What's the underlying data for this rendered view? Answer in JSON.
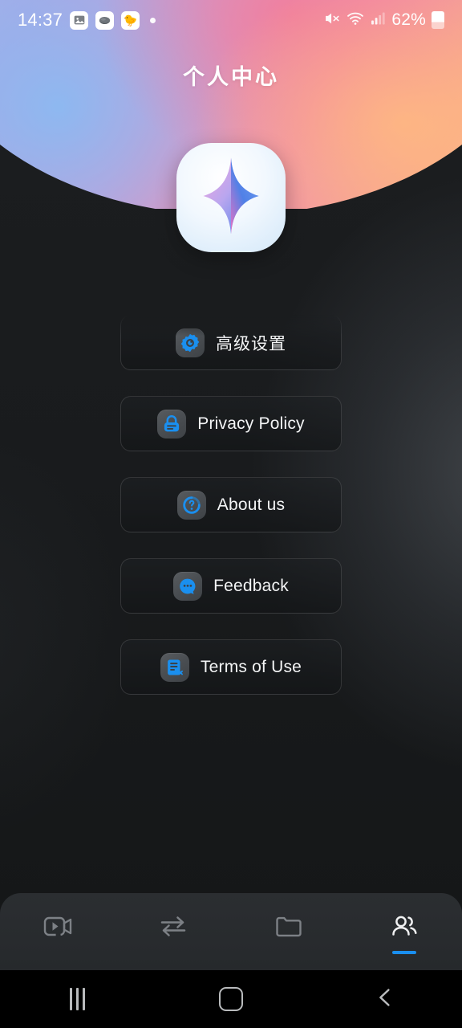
{
  "status_bar": {
    "time": "14:37",
    "left_icons": [
      "photo-icon",
      "cloud-icon",
      "chick-icon",
      "dot-indicator"
    ],
    "chick_glyph": "🐤",
    "right_icons": [
      "mute-icon",
      "wifi-icon",
      "signal-icon"
    ],
    "battery_percent": "62%"
  },
  "header": {
    "title": "个人中心",
    "logo_icon": "sparkle-star-icon",
    "gradient_from": "#9fc3ef",
    "gradient_mid": "#ef8fae",
    "gradient_to": "#f6c18c"
  },
  "menu": {
    "items": [
      {
        "label": "高级设置",
        "icon": "gear-icon",
        "cjk": true
      },
      {
        "label": "Privacy Policy",
        "icon": "lock-icon",
        "cjk": false
      },
      {
        "label": "About us",
        "icon": "question-circle-icon",
        "cjk": false
      },
      {
        "label": "Feedback",
        "icon": "chat-bubble-icon",
        "cjk": false
      },
      {
        "label": "Terms of Use",
        "icon": "document-icon",
        "cjk": false
      }
    ],
    "icon_color": "#1a8fef"
  },
  "tab_bar": {
    "accent": "#1a8fef",
    "tabs": [
      {
        "name": "video",
        "icon": "video-camera-icon",
        "active": false
      },
      {
        "name": "transfer",
        "icon": "transfer-arrows-icon",
        "active": false
      },
      {
        "name": "files",
        "icon": "folder-icon",
        "active": false
      },
      {
        "name": "profile",
        "icon": "people-icon",
        "active": true
      }
    ]
  },
  "nav_bar": {
    "buttons": [
      "recents-button",
      "home-button",
      "back-button"
    ]
  }
}
